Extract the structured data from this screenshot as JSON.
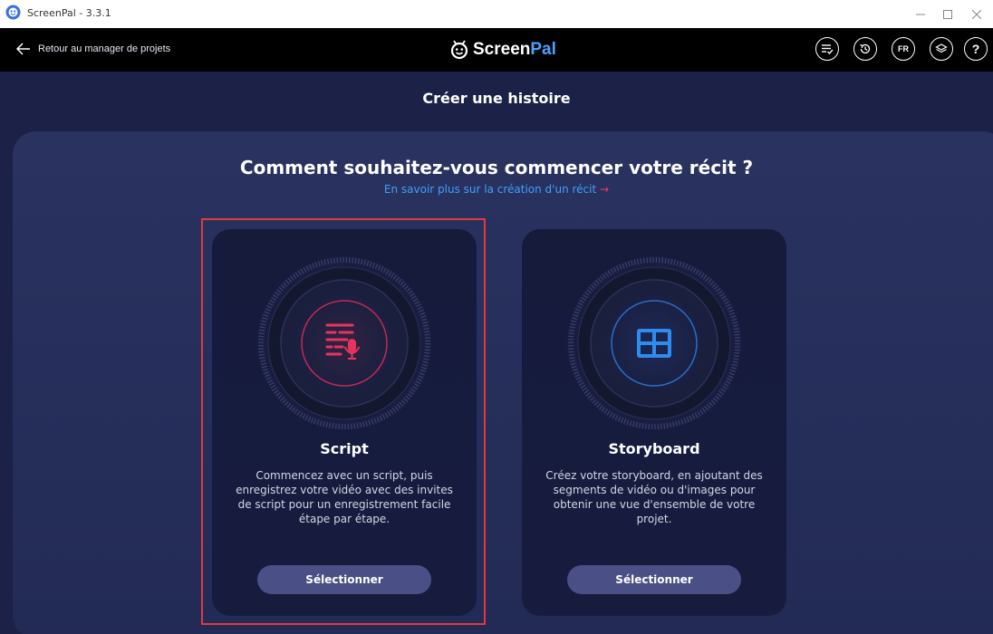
{
  "window": {
    "title": "ScreenPal - 3.3.1"
  },
  "topbar": {
    "back_label": "Retour au manager de projets",
    "brand_part1": "Screen",
    "brand_part2": "Pal",
    "lang_label": "FR",
    "help_label": "?",
    "icons": [
      "checklist-icon",
      "history-icon",
      "language-button",
      "layers-icon",
      "help-icon"
    ]
  },
  "page": {
    "title": "Créer une histoire",
    "question": "Comment souhaitez-vous commencer votre récit ?",
    "learn_more": "En savoir plus sur la création d'un récit",
    "learn_more_arrow": "→"
  },
  "cards": [
    {
      "title": "Script",
      "description": "Commencez avec un script, puis enregistrez votre vidéo avec des invites de script pour un enregistrement facile étape par étape.",
      "button_label": "Sélectionner",
      "icon": "script-mic-icon",
      "accent": "#e8335f",
      "selected": true
    },
    {
      "title": "Storyboard",
      "description": "Créez votre storyboard, en ajoutant des segments de vidéo ou d'images pour obtenir une vue d'ensemble de votre projet.",
      "button_label": "Sélectionner",
      "icon": "storyboard-grid-icon",
      "accent": "#2e8cf0",
      "selected": false
    }
  ],
  "colors": {
    "background": "#1c2247",
    "topbar": "#000000",
    "link": "#3fa0ff",
    "highlight": "#e03a3e",
    "button": "#4a4f86"
  }
}
